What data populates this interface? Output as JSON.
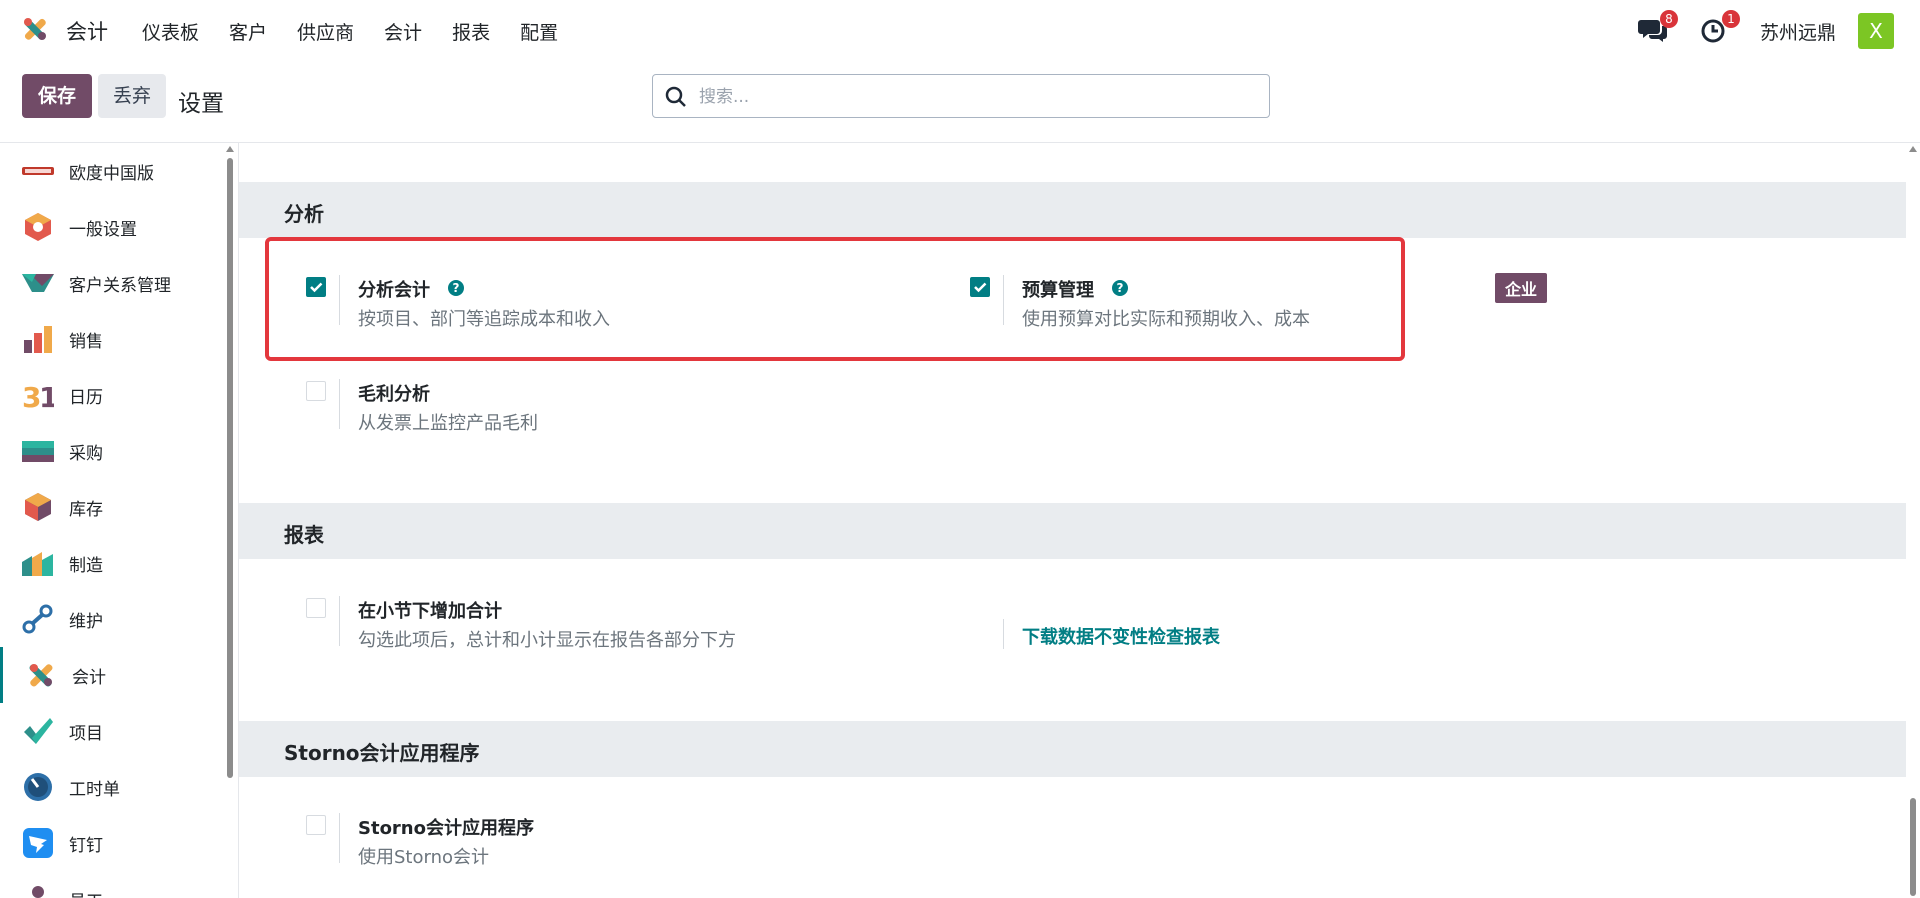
{
  "navbar": {
    "app_title": "会计",
    "menu": [
      "仪表板",
      "客户",
      "供应商",
      "会计",
      "报表",
      "配置"
    ],
    "messages_badge": "8",
    "activities_badge": "1",
    "company": "苏州远鼎",
    "avatar_letter": "X"
  },
  "control_panel": {
    "save_label": "保存",
    "discard_label": "丢弃",
    "breadcrumb": "设置",
    "search_placeholder": "搜索..."
  },
  "sidebar": {
    "items": [
      {
        "label": "欧度中国版",
        "icon": "oudu-logo-icon"
      },
      {
        "label": "一般设置",
        "icon": "general-settings-icon"
      },
      {
        "label": "客户关系管理",
        "icon": "crm-icon"
      },
      {
        "label": "销售",
        "icon": "sales-icon"
      },
      {
        "label": "日历",
        "icon": "calendar-icon"
      },
      {
        "label": "采购",
        "icon": "purchase-icon"
      },
      {
        "label": "库存",
        "icon": "inventory-icon"
      },
      {
        "label": "制造",
        "icon": "manufacturing-icon"
      },
      {
        "label": "维护",
        "icon": "maintenance-icon"
      },
      {
        "label": "会计",
        "icon": "accounting-icon"
      },
      {
        "label": "项目",
        "icon": "project-icon"
      },
      {
        "label": "工时单",
        "icon": "timesheet-icon"
      },
      {
        "label": "钉钉",
        "icon": "dingtalk-icon"
      },
      {
        "label": "员工",
        "icon": "employees-icon"
      }
    ]
  },
  "sections": {
    "analytics": {
      "title": "分析",
      "analytic_accounting": {
        "title": "分析会计",
        "desc": "按项目、部门等追踪成本和收入",
        "checked": true
      },
      "budget": {
        "title": "预算管理",
        "desc": "使用预算对比实际和预期收入、成本",
        "checked": true
      },
      "enterprise_badge": "企业",
      "margin": {
        "title": "毛利分析",
        "desc": "从发票上监控产品毛利",
        "checked": false
      }
    },
    "reports": {
      "title": "报表",
      "subtotal": {
        "title": "在小节下增加合计",
        "desc": "勾选此项后，总计和小计显示在报告各部分下方",
        "checked": false
      },
      "download_link": "下载数据不变性检查报表"
    },
    "storno": {
      "title": "Storno会计应用程序",
      "storno": {
        "title": "Storno会计应用程序",
        "desc": "使用Storno会计",
        "checked": false
      }
    }
  },
  "colors": {
    "brand": "#714b67",
    "accent": "#017e84",
    "highlight": "#e3373d",
    "badge": "#d9343a"
  }
}
